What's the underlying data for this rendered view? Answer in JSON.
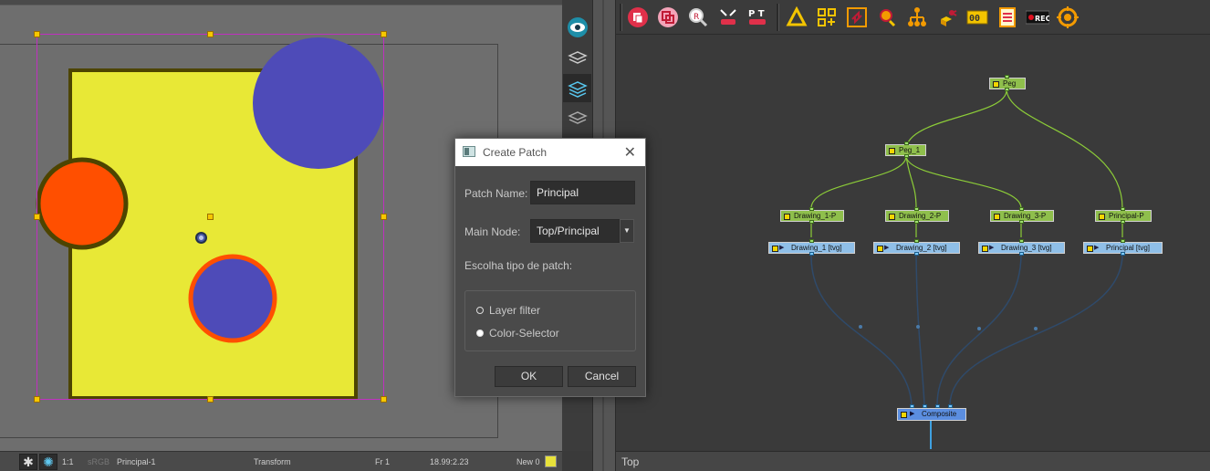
{
  "camera": {
    "colors": {
      "background": "#6e6e6e",
      "rect_fill": "#e8e836",
      "rect_stroke": "#4d4400",
      "big_circle": "#4e4bb8",
      "orange_circle": "#ff4f00",
      "orange_stroke": "#4d4400",
      "small_circle": "#4e4bb8",
      "small_stroke": "#ff4f00"
    }
  },
  "camera_status": {
    "zoom": "1:1",
    "channel": "sRGB",
    "drawing": "Principal-1",
    "tool": "Transform",
    "frame": "Fr 1",
    "coords": "18.99:2.23",
    "new": "New 0"
  },
  "layer_strip": {
    "buttons": [
      {
        "icon": "eye-icon"
      },
      {
        "icon": "layers-icon"
      },
      {
        "icon": "layers-icon"
      },
      {
        "icon": "layers-icon"
      }
    ]
  },
  "toolbar": {
    "tools": [
      "create-patch-icon",
      "clone-icon",
      "search-node-icon",
      "peg-arrows-icon",
      "pt-icon",
      "triangle-recycle-icon",
      "grid-add-icon",
      "swap-node-icon",
      "node-pin-icon",
      "hierarchy-icon",
      "cube-network-icon",
      "counter-icon",
      "checklist-icon",
      "rec-icon",
      "target-icon"
    ],
    "pt_label": "P T",
    "counter_label": "00",
    "rec_label": "REC"
  },
  "nodes": {
    "peg": "Peg",
    "peg_1": "Peg_1",
    "pegs": [
      "Drawing_1-P",
      "Drawing_2-P",
      "Drawing_3-P",
      "Principal-P"
    ],
    "drawings": [
      "Drawing_1  [tvg]",
      "Drawing_2  [tvg]",
      "Drawing_3  [tvg]",
      "Principal  [tvg]"
    ],
    "composite": "Composite"
  },
  "node_status": {
    "view": "Top"
  },
  "dialog": {
    "title": "Create Patch",
    "close": "✕",
    "patch_name_label": "Patch Name:",
    "patch_name_value": "Principal",
    "main_node_label": "Main Node:",
    "main_node_value": "Top/Principal",
    "combo_arrow": "▼",
    "patch_type_label": "Escolha tipo de patch:",
    "options": [
      "Layer filter",
      "Color-Selector"
    ],
    "selected_option": "Color-Selector",
    "ok": "OK",
    "cancel": "Cancel"
  }
}
